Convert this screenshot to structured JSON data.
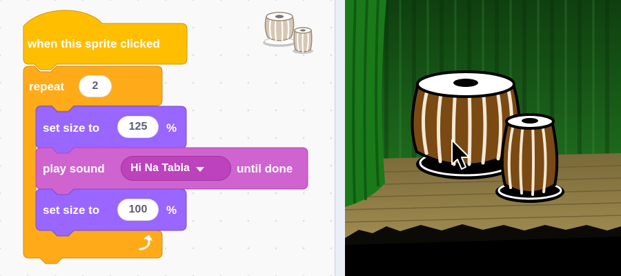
{
  "code_area": {
    "hat_label": "when this sprite clicked",
    "repeat_label": "repeat",
    "repeat_count": "2",
    "set_size_label_1": "set size to",
    "set_size_value_1": "125",
    "percent_1": "%",
    "play_sound_label": "play sound",
    "sound_name": "Hi Na Tabla",
    "until_done_label": "until done",
    "set_size_label_2": "set size to",
    "set_size_value_2": "100",
    "percent_2": "%"
  },
  "sprite_thumbnail": {
    "icon": "tabla-sprite-icon"
  },
  "stage": {
    "backdrop": "theater-stage",
    "sprite": "tabla",
    "cursor": "mouse-pointer-icon"
  },
  "colors": {
    "events": "#ffbf00",
    "control": "#ffab19",
    "looks": "#9966ff",
    "sound": "#cf63cf"
  }
}
